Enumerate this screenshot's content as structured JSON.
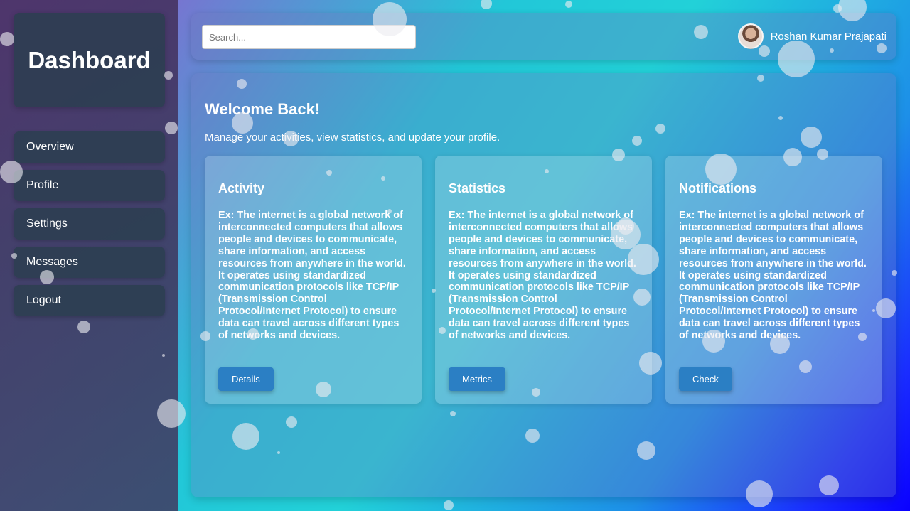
{
  "sidebar": {
    "title": "Dashboard",
    "items": [
      {
        "label": "Overview"
      },
      {
        "label": "Profile"
      },
      {
        "label": "Settings"
      },
      {
        "label": "Messages"
      },
      {
        "label": "Logout"
      }
    ]
  },
  "header": {
    "search_placeholder": "Search...",
    "user_name": "Roshan Kumar Prajapati",
    "avatar_icon": "user-avatar-photo"
  },
  "main": {
    "welcome": "Welcome Back!",
    "subtitle": "Manage your activities, view statistics, and update your profile.",
    "cards": [
      {
        "title": "Activity",
        "text": "Ex: The internet is a global network of interconnected computers that allows people and devices to communicate, share information, and access resources from anywhere in the world. It operates using standardized communication protocols like TCP/IP (Transmission Control Protocol/Internet Protocol) to ensure data can travel across different types of networks and devices.",
        "button": "Details"
      },
      {
        "title": "Statistics",
        "text": "Ex: The internet is a global network of interconnected computers that allows people and devices to communicate, share information, and access resources from anywhere in the world. It operates using standardized communication protocols like TCP/IP (Transmission Control Protocol/Internet Protocol) to ensure data can travel across different types of networks and devices.",
        "button": "Metrics"
      },
      {
        "title": "Notifications",
        "text": "Ex: The internet is a global network of interconnected computers that allows people and devices to communicate, share information, and access resources from anywhere in the world. It operates using standardized communication protocols like TCP/IP (Transmission Control Protocol/Internet Protocol) to ensure data can travel across different types of networks and devices.",
        "button": "Check"
      }
    ]
  },
  "colors": {
    "panel": "#2c3e50",
    "button": "#2b7fc4",
    "bubble": "#ebebf0"
  }
}
